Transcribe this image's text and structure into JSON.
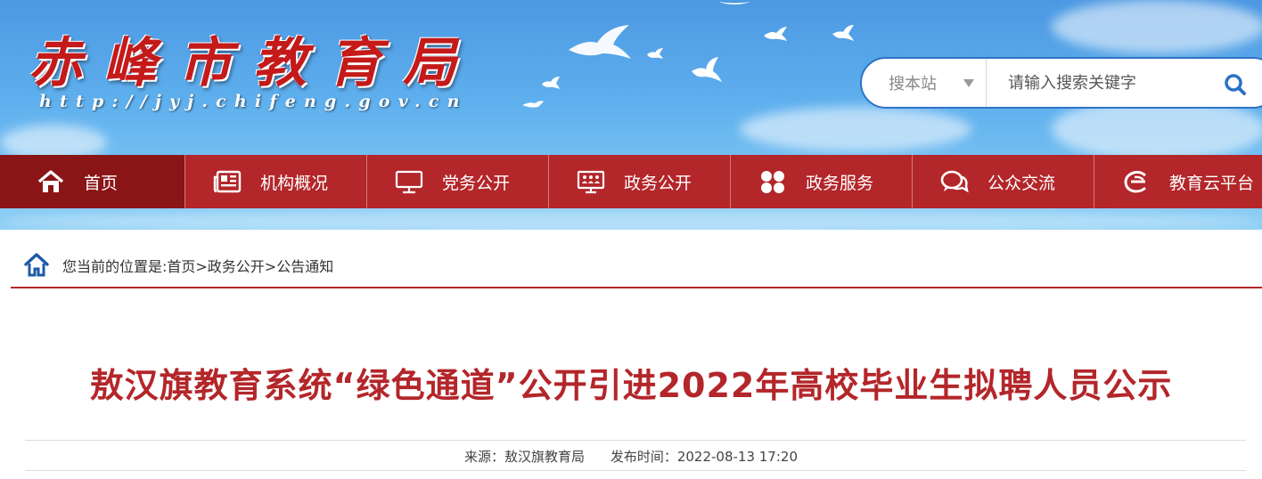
{
  "header": {
    "site_title": "赤峰市教育局",
    "site_url": "http://jyj.chifeng.gov.cn"
  },
  "search": {
    "scope_label": "搜本站",
    "placeholder": "请输入搜索关键字"
  },
  "nav": {
    "items": [
      {
        "label": "首页",
        "icon": "home-icon"
      },
      {
        "label": "机构概况",
        "icon": "newspaper-icon"
      },
      {
        "label": "党务公开",
        "icon": "monitor-icon"
      },
      {
        "label": "政务公开",
        "icon": "presentation-icon"
      },
      {
        "label": "政务服务",
        "icon": "grid-icon"
      },
      {
        "label": "公众交流",
        "icon": "chat-icon"
      },
      {
        "label": "教育云平台",
        "icon": "cloud-e-icon"
      }
    ]
  },
  "breadcrumb": {
    "text": "您当前的位置是:首页>政务公开>公告通知"
  },
  "article": {
    "title": "敖汉旗教育系统“绿色通道”公开引进2022年高校毕业生拟聘人员公示",
    "source": "来源：敖汉旗教育局",
    "published": "发布时间：2022-08-13 17:20"
  },
  "colors": {
    "brand_red": "#b3262a",
    "nav_active": "#8a1516",
    "search_border": "#2d73c7",
    "banner_sky": "#5fb0ee"
  }
}
